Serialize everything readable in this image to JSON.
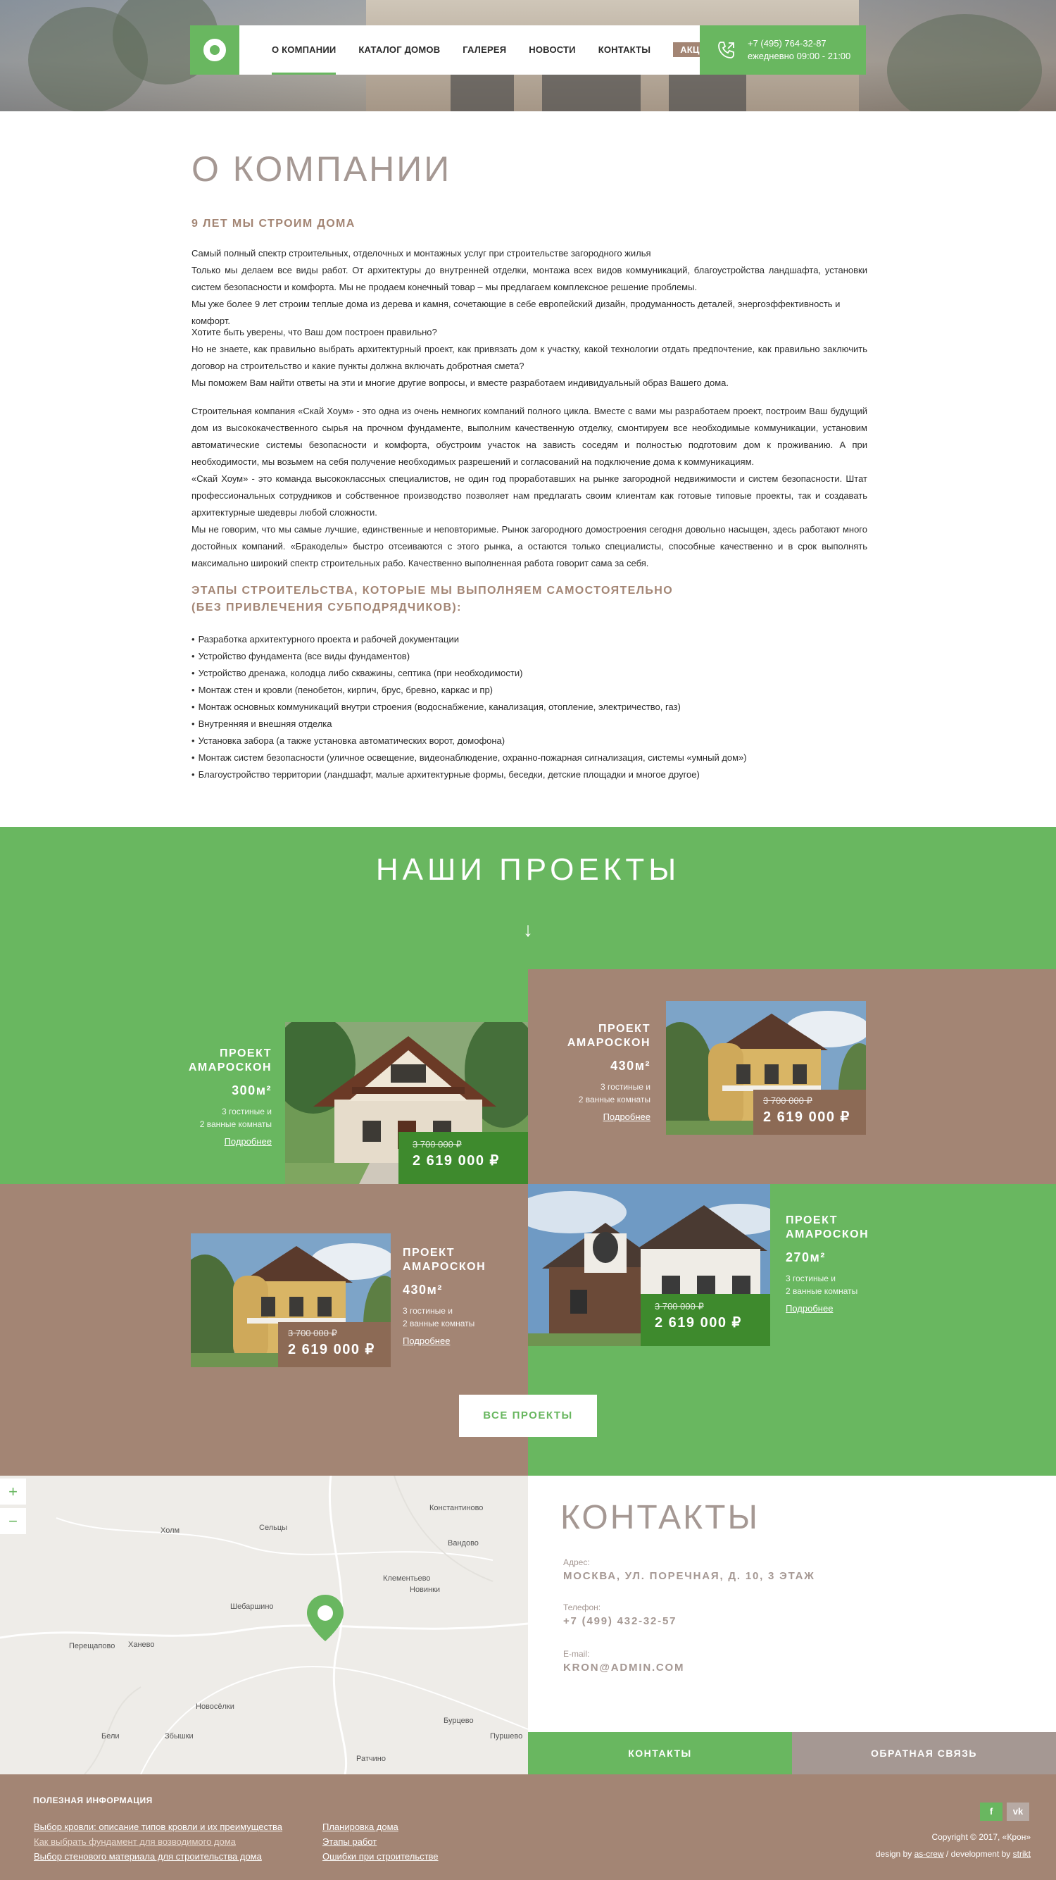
{
  "nav": {
    "items": [
      "О КОМПАНИИ",
      "КАТАЛОГ ДОМОВ",
      "ГАЛЕРЕЯ",
      "НОВОСТИ",
      "КОНТАКТЫ",
      "АКЦИИ"
    ],
    "phone": "+7 (495) 764-32-87",
    "hours": "ежедневно 09:00 - 21:00"
  },
  "about": {
    "title": "О КОМПАНИИ",
    "subtitle": "9 ЛЕТ МЫ СТРОИМ ДОМА",
    "p1": [
      "Самый полный спектр строительных, отделочных и монтажных услуг при строительстве загородного жилья",
      "Только мы делаем все виды работ. От архитектуры до внутренней отделки, монтажа всех видов коммуникаций, благоустройства ландшафта, установки систем безопасности и комфорта. Мы не продаем конечный товар – мы предлагаем комплексное решение проблемы.",
      "Мы уже более 9 лет строим теплые дома из дерева и камня, сочетающие в себе европейский дизайн, продуманность деталей, энергоэффективность и комфорт."
    ],
    "p2": [
      "Хотите быть уверены, что Ваш дом построен правильно?",
      "Но не знаете, как правильно выбрать архитектурный проект, как привязать дом к участку, какой технологии отдать предпочтение, как правильно заключить договор на строительство и какие пункты должна включать добротная смета?",
      "Мы поможем Вам найти ответы на эти и многие другие вопросы, и вместе разработаем индивидуальный образ Вашего дома."
    ],
    "p3": [
      "Строительная компания «Скай Хоум» - это одна из очень немногих компаний полного цикла. Вместе с вами мы разработаем проект, построим Ваш будущий дом из высококачественного сырья на прочном фундаменте, выполним качественную отделку, смонтируем все необходимые коммуникации, установим автоматические системы безопасности и комфорта, обустроим участок на зависть соседям и полностью подготовим дом к проживанию. А при необходимости, мы возьмем на себя получение необходимых разрешений и согласований на подключение дома к коммуникациям.",
      "«Скай Хоум» - это команда высококлассных специалистов, не один год проработавших на рынке загородной недвижимости и систем безопасности. Штат профессиональных сотрудников и собственное производство позволяет нам предлагать своим клиентам как готовые типовые проекты, так и создавать архитектурные шедевры любой сложности.",
      "Мы не говорим, что мы самые лучшие, единственные и неповторимые. Рынок загородного домостроения сегодня довольно насыщен, здесь работают много достойных компаний. «Бракоделы» быстро отсеиваются с этого рынка, а остаются только специалисты, способные качественно и в срок выполнять максимально широкий спектр строительных рабо. Качественно выполненная работа говорит сама за себя."
    ],
    "stages_title_1": "ЭТАПЫ СТРОИТЕЛЬСТВА, КОТОРЫЕ МЫ ВЫПОЛНЯЕМ САМОСТОЯТЕЛЬНО",
    "stages_title_2": "(БЕЗ ПРИВЛЕЧЕНИЯ СУБПОДРЯДЧИКОВ):",
    "stages": [
      "Разработка архитектурного проекта и рабочей документации",
      "Устройство фундамента (все виды фундаментов)",
      "Устройство дренажа, колодца либо скважины, септика (при необходимости)",
      "Монтаж стен и кровли (пенобетон, кирпич, брус, бревно, каркас и пр)",
      "Монтаж основных коммуникаций внутри строения (водоснабжение, канализация, отопление, электричество, газ)",
      "Внутренняя и внешняя отделка",
      "Установка забора (а также установка автоматических ворот, домофона)",
      "Монтаж систем безопасности (уличное освещение, видеонаблюдение, охранно-пожарная сигнализация, системы «умный дом»)",
      "Благоустройство территории (ландшафт, малые архитектурные формы, беседки, детские площадки и многое другое)"
    ]
  },
  "projects": {
    "title": "НАШИ ПРОЕКТЫ",
    "arrow": "↓",
    "items": [
      {
        "t1": "ПРОЕКТ",
        "t2": "АМАРОСКОН",
        "area": "300м²",
        "r1": "3 гостиные и",
        "r2": "2 ванные комнаты",
        "more": "Подробнее",
        "old": "3 700 000 ₽",
        "new": "2 619 000 ₽"
      },
      {
        "t1": "ПРОЕКТ",
        "t2": "АМАРОСКОН",
        "area": "430м²",
        "r1": "3 гостиные и",
        "r2": "2 ванные комнаты",
        "more": "Подробнее",
        "old": "3 700 000 ₽",
        "new": "2 619 000 ₽"
      },
      {
        "t1": "ПРОЕКТ",
        "t2": "АМАРОСКОН",
        "area": "430м²",
        "r1": "3 гостиные и",
        "r2": "2 ванные комнаты",
        "more": "Подробнее",
        "old": "3 700 000 ₽",
        "new": "2 619 000 ₽"
      },
      {
        "t1": "ПРОЕКТ",
        "t2": "АМАРОСКОН",
        "area": "270м²",
        "r1": "3 гостиные и",
        "r2": "2 ванные комнаты",
        "more": "Подробнее",
        "old": "3 700 000 ₽",
        "new": "2 619 000 ₽"
      }
    ],
    "all_button": "ВСЕ ПРОЕКТЫ"
  },
  "map": {
    "zoom_in": "+",
    "zoom_out": "−",
    "places": [
      "Константиново",
      "Холм",
      "Сельцы",
      "Вандово",
      "Клементьево",
      "Новинки",
      "Шебаршино",
      "Перещапово",
      "Ханево",
      "Новосёлки",
      "Бурцево",
      "Бели",
      "Збышки",
      "Пуршево",
      "Ратчино"
    ]
  },
  "contacts": {
    "title": "КОНТАКТЫ",
    "address_label": "Адрес:",
    "address": "МОСКВА, УЛ. ПОРЕЧНАЯ, Д. 10, 3 ЭТАЖ",
    "phone_label": "Телефон:",
    "phone": "+7 (499) 432-32-57",
    "email_label": "E-mail:",
    "email": "KRON@ADMIN.COM",
    "btn_contacts": "КОНТАКТЫ",
    "btn_feedback": "ОБРАТНАЯ СВЯЗЬ"
  },
  "footer": {
    "title": "ПОЛЕЗНАЯ ИНФОРМАЦИЯ",
    "col1": [
      "Выбор кровли: описание типов кровли и их преимущества",
      "Как выбрать фундамент для возводимого дома",
      "Выбор стенового материала для строительства дома"
    ],
    "col2": [
      "Планировка дома",
      "Этапы работ",
      "Ошибки при строительстве"
    ],
    "social": [
      "f",
      "vk"
    ],
    "copyright": "Copyright ©  2017, «Крон»",
    "design_by": "design by",
    "design_link": "as-crew",
    "dev_by": "/ development by",
    "dev_link": "strikt"
  },
  "colors": {
    "green": "#69b760",
    "brown": "#a38574",
    "dark_green": "#3e8a2d",
    "muted": "#a59893"
  }
}
